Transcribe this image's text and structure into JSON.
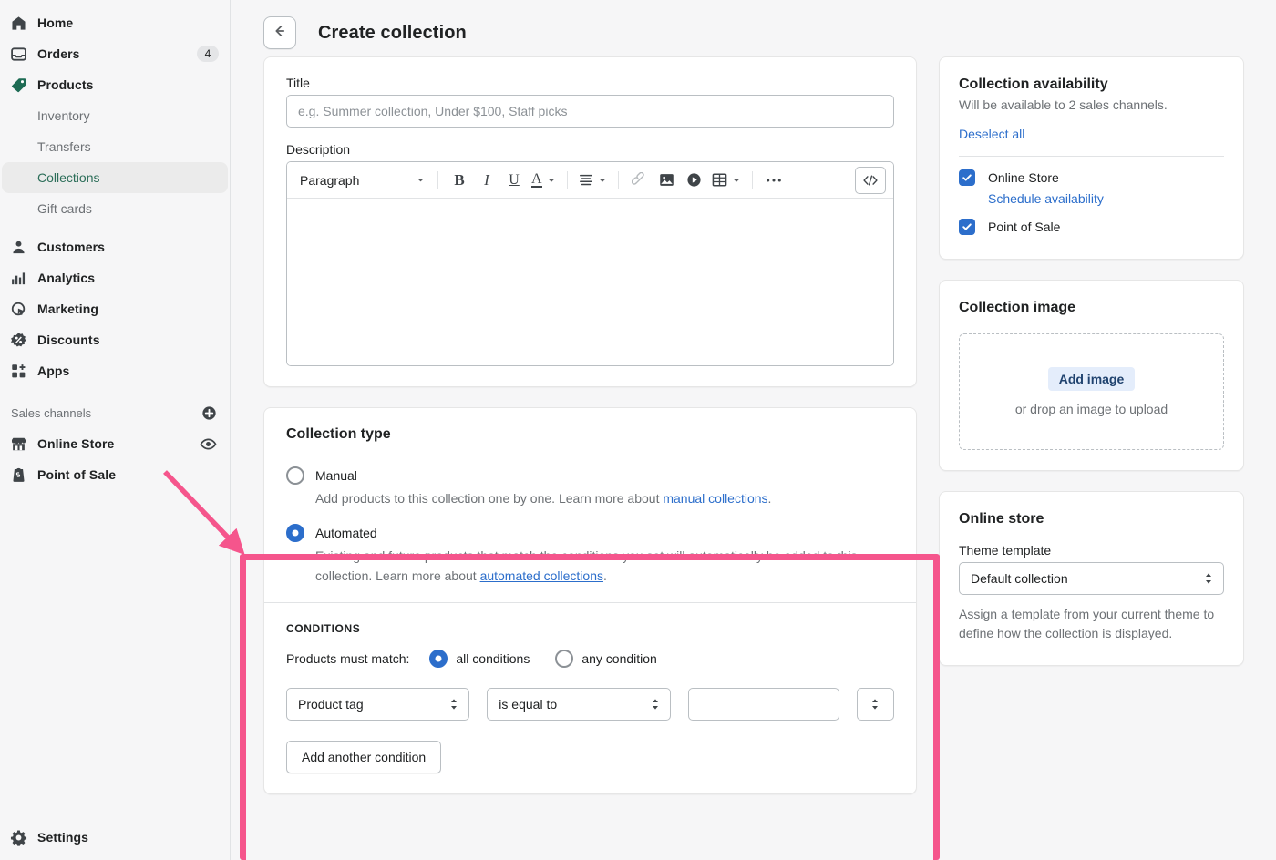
{
  "sidebar": {
    "items": [
      {
        "label": "Home",
        "icon": "home-icon",
        "badge": null
      },
      {
        "label": "Orders",
        "icon": "orders-inbox-icon",
        "badge": "4"
      },
      {
        "label": "Products",
        "icon": "products-tag-icon",
        "badge": null
      }
    ],
    "product_subitems": [
      {
        "label": "Inventory",
        "active": false
      },
      {
        "label": "Transfers",
        "active": false
      },
      {
        "label": "Collections",
        "active": true
      },
      {
        "label": "Gift cards",
        "active": false
      }
    ],
    "items2": [
      {
        "label": "Customers",
        "icon": "customer-person-icon"
      },
      {
        "label": "Analytics",
        "icon": "analytics-bars-icon"
      },
      {
        "label": "Marketing",
        "icon": "marketing-target-icon"
      },
      {
        "label": "Discounts",
        "icon": "discounts-badge-icon"
      },
      {
        "label": "Apps",
        "icon": "apps-grid-icon"
      }
    ],
    "sales_channels_header": "Sales channels",
    "sales_channels": [
      {
        "label": "Online Store",
        "icon": "storefront-icon",
        "action_icon": "eye-icon"
      },
      {
        "label": "Point of Sale",
        "icon": "pos-icon",
        "action_icon": null
      }
    ],
    "settings": {
      "label": "Settings",
      "icon": "gear-icon"
    }
  },
  "header": {
    "back_icon": "arrow-left-icon",
    "title": "Create collection"
  },
  "details_card": {
    "title_label": "Title",
    "title_value": "",
    "title_placeholder": "e.g. Summer collection, Under $100, Staff picks",
    "description_label": "Description",
    "description_value": "",
    "toolbar": {
      "block_format": "Paragraph",
      "buttons": [
        {
          "name": "bold-icon",
          "glyph": "B"
        },
        {
          "name": "italic-icon",
          "glyph": "I"
        },
        {
          "name": "underline-icon",
          "glyph": "U"
        },
        {
          "name": "text-color-icon",
          "glyph": "A"
        },
        {
          "name": "align-icon",
          "glyph": "≡"
        },
        {
          "name": "link-icon",
          "glyph": "link"
        },
        {
          "name": "image-icon",
          "glyph": "image"
        },
        {
          "name": "video-icon",
          "glyph": "video"
        },
        {
          "name": "table-icon",
          "glyph": "table"
        },
        {
          "name": "more-options-icon",
          "glyph": "•••"
        },
        {
          "name": "html-code-icon",
          "glyph": "</>"
        }
      ]
    }
  },
  "collection_type": {
    "heading": "Collection type",
    "options": [
      {
        "label": "Manual",
        "selected": false,
        "help_before": "Add products to this collection one by one. Learn more about ",
        "help_link": "manual collections",
        "help_after": "."
      },
      {
        "label": "Automated",
        "selected": true,
        "help_before": "Existing and future products that match the conditions you set will automatically be added to this collection. Learn more about ",
        "help_link": "automated collections",
        "help_after": "."
      }
    ]
  },
  "conditions": {
    "heading": "CONDITIONS",
    "match_label": "Products must match:",
    "match_options": [
      {
        "label": "all conditions",
        "selected": true
      },
      {
        "label": "any condition",
        "selected": false
      }
    ],
    "row": {
      "field_value": "Product tag",
      "operator_value": "is equal to",
      "value": "",
      "value_placeholder": ""
    },
    "add_button": "Add another condition"
  },
  "availability": {
    "title": "Collection availability",
    "subtitle": "Will be available to 2 sales channels.",
    "deselect_all": "Deselect all",
    "channels": [
      {
        "label": "Online Store",
        "checked": true,
        "sub_link": "Schedule availability"
      },
      {
        "label": "Point of Sale",
        "checked": true,
        "sub_link": null
      }
    ]
  },
  "collection_image": {
    "title": "Collection image",
    "add_button": "Add image",
    "drop_hint": "or drop an image to upload"
  },
  "online_store": {
    "title": "Online store",
    "theme_label": "Theme template",
    "theme_value": "Default collection",
    "help": "Assign a template from your current theme to define how the collection is displayed."
  },
  "annotations": {
    "highlight_color": "#f5558c",
    "arrow_color": "#f5558c"
  },
  "colors": {
    "accent_blue": "#2c6ecb",
    "active_green": "#2c6e59",
    "page_bg": "#f6f6f7",
    "card_bg": "#ffffff",
    "border": "#babfc3"
  }
}
